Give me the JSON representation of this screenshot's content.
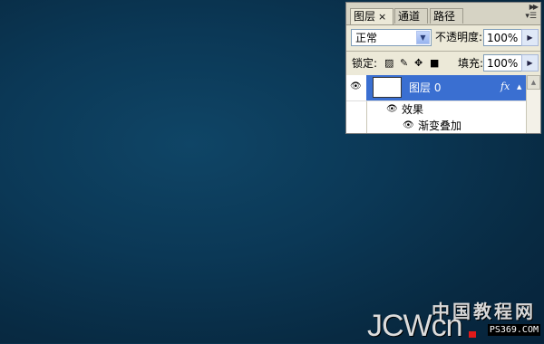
{
  "panel": {
    "tabs": [
      {
        "label": "图层",
        "close": "×"
      },
      {
        "label": "通道"
      },
      {
        "label": "路径"
      }
    ],
    "menu_icon": "panel-menu-icon",
    "blend_mode": "正常",
    "opacity_label": "不透明度:",
    "opacity_value": "100%",
    "lock_label": "锁定:",
    "lock_icons": [
      "lock-transparent-icon",
      "lock-paint-icon",
      "lock-move-icon",
      "lock-all-icon"
    ],
    "fill_label": "填充:",
    "fill_value": "100%"
  },
  "layers": [
    {
      "name": "图层 0",
      "fx": "fx",
      "selected": true
    }
  ],
  "effects": {
    "label": "效果",
    "items": [
      "渐变叠加"
    ]
  },
  "watermark": {
    "cn": "中国教程网",
    "en": "JCWcn",
    "url": "PS369.COM"
  },
  "colors": {
    "canvas": "#0b3856",
    "selection": "#3a6fd1",
    "panel_bg": "#ece9d8"
  }
}
